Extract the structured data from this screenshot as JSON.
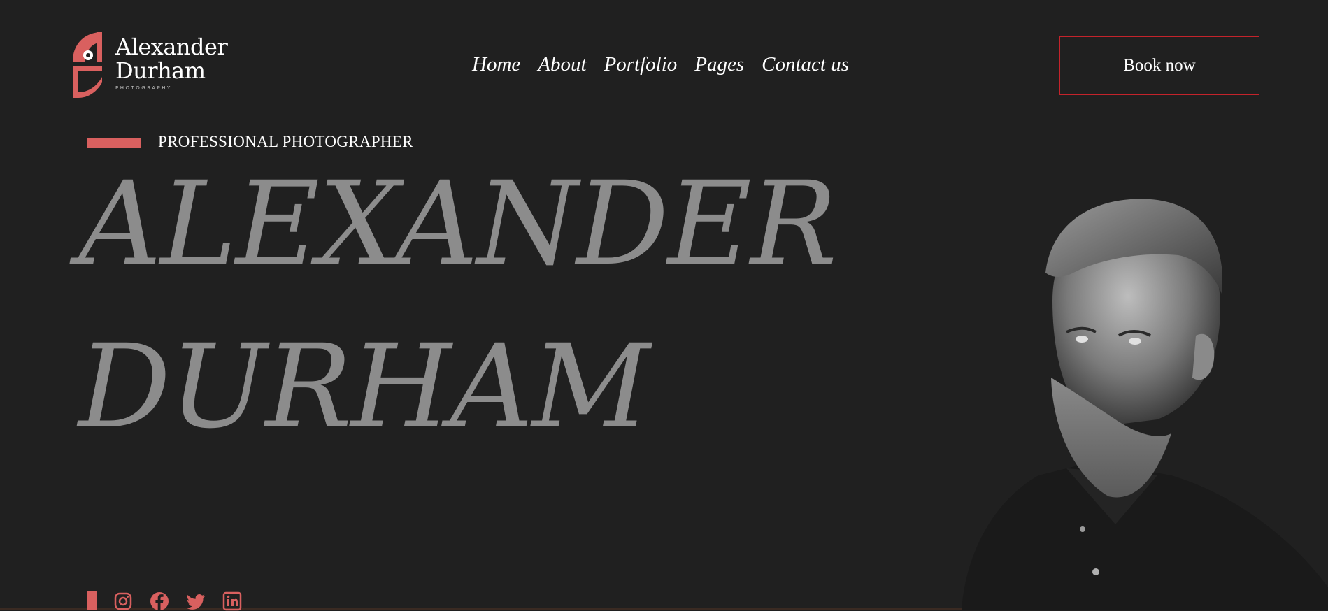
{
  "brand": {
    "line1": "Alexander",
    "line2": "Durham",
    "sub": "PHOTOGRAPHY",
    "accent": "#d9605f"
  },
  "nav": {
    "items": [
      "Home",
      "About",
      "Portfolio",
      "Pages",
      "Contact us"
    ]
  },
  "cta": {
    "label": "Book now",
    "border_color": "#c4232b"
  },
  "hero": {
    "tagline": "PROFESSIONAL PHOTOGRAPHER",
    "name_line1": "ALEXANDER",
    "name_line2": "DURHAM"
  },
  "social": {
    "icons": [
      "instagram-icon",
      "facebook-icon",
      "twitter-icon",
      "linkedin-icon"
    ]
  },
  "colors": {
    "background": "#202020",
    "hero_text": "#8c8c8c"
  }
}
